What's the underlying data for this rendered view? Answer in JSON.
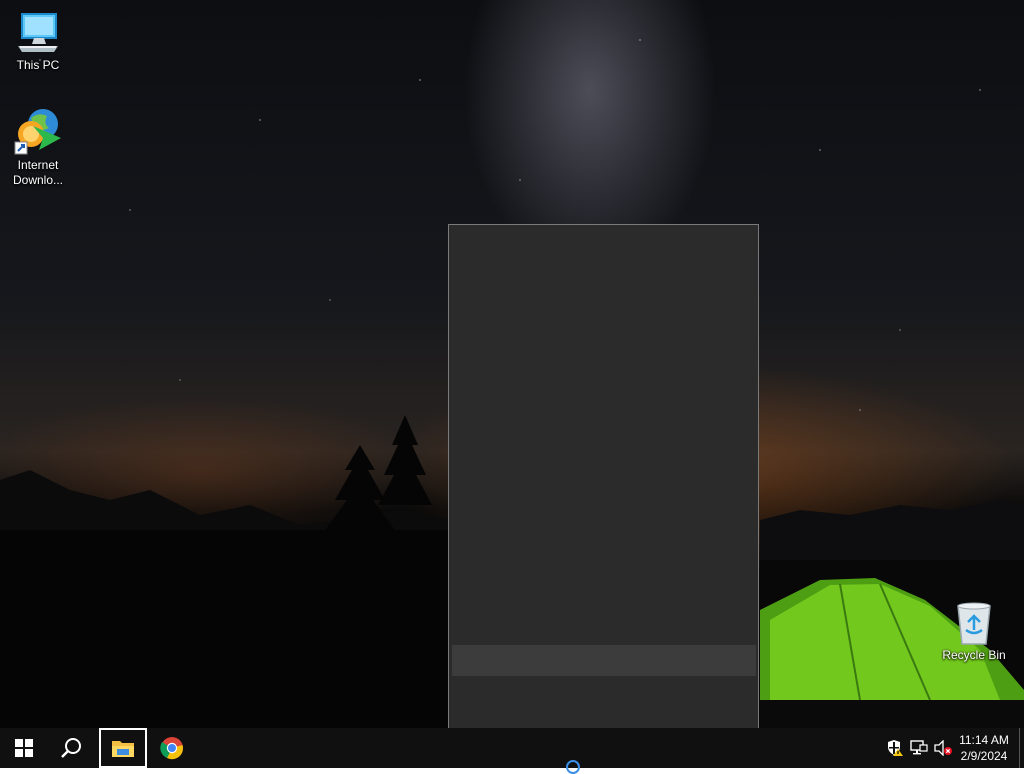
{
  "desktop": {
    "icons": [
      {
        "label": "This PC",
        "icon": "this-pc-icon"
      },
      {
        "label": "Internet Downlo...",
        "icon": "internet-download-manager-icon"
      },
      {
        "label": "Recycle Bin",
        "icon": "recycle-bin-icon"
      }
    ]
  },
  "taskbar": {
    "buttons": [
      {
        "icon": "windows-start-icon"
      },
      {
        "icon": "search-icon"
      },
      {
        "icon": "file-explorer-icon"
      },
      {
        "icon": "chrome-icon"
      }
    ],
    "tray": [
      {
        "icon": "security-shield-warning-icon"
      },
      {
        "icon": "network-icon"
      },
      {
        "icon": "volume-muted-icon"
      }
    ],
    "clock": {
      "time": "11:14 AM",
      "date": "2/9/2024"
    }
  },
  "colors": {
    "taskbar": "#101010",
    "popup_background": "#2b2b2b",
    "popup_highlight": "#3c3c3c",
    "accent": "#3b8fe8"
  }
}
